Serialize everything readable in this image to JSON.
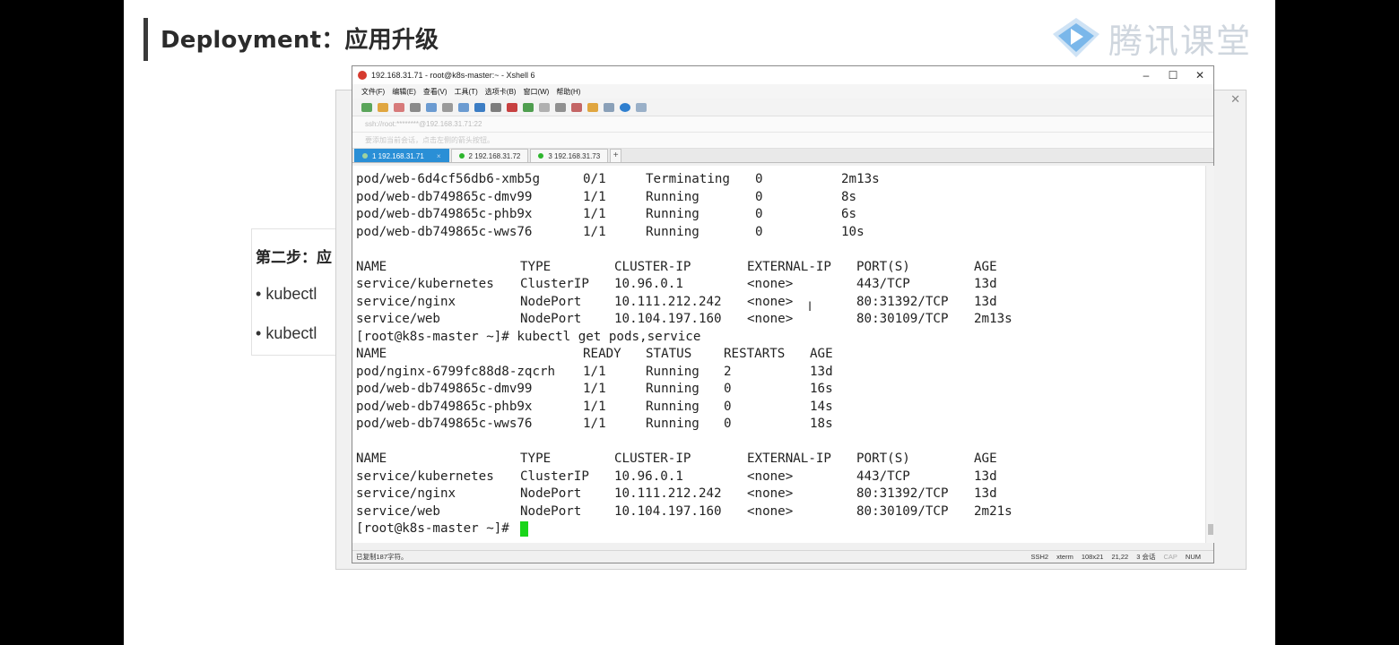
{
  "slide": {
    "title": "Deployment：应用升级",
    "logo_text": "腾讯课堂",
    "behind": {
      "step_label": "第二步：应",
      "bullets": [
        "kubectl",
        "kubectl"
      ]
    }
  },
  "window": {
    "title": "192.168.31.71 - root@k8s-master:~ - Xshell 6",
    "controls": [
      "–",
      "☐",
      "✕"
    ],
    "menu": [
      "文件(F)",
      "编辑(E)",
      "查看(V)",
      "工具(T)",
      "选项卡(B)",
      "窗口(W)",
      "帮助(H)"
    ],
    "address": "ssh://root:********@192.168.31.71:22",
    "hint": "要添加当前会话，点击左侧的箭头按钮。",
    "tabs": [
      {
        "label": "1 192.168.31.71",
        "active": true
      },
      {
        "label": "2 192.168.31.72",
        "active": false
      },
      {
        "label": "3 192.168.31.73",
        "active": false
      }
    ],
    "tab_add": "+",
    "status": {
      "left": "已复制187字符。",
      "items": [
        "SSH2",
        "xterm",
        "108x21",
        "21,22",
        "3 会话",
        "CAP",
        "NUM"
      ]
    }
  },
  "terminal": {
    "lines": [
      [
        "pod/web-6d4cf56db6-xmb5g",
        "0/1",
        "Terminating",
        "0",
        "2m13s"
      ],
      [
        "pod/web-db749865c-dmv99",
        "1/1",
        "Running",
        "0",
        "8s"
      ],
      [
        "pod/web-db749865c-phb9x",
        "1/1",
        "Running",
        "0",
        "6s"
      ],
      [
        "pod/web-db749865c-wws76",
        "1/1",
        "Running",
        "0",
        "10s"
      ],
      [],
      [
        "NAME",
        "TYPE",
        "CLUSTER-IP",
        "EXTERNAL-IP",
        "PORT(S)",
        "AGE"
      ],
      [
        "service/kubernetes",
        "ClusterIP",
        "10.96.0.1",
        "<none>",
        "443/TCP",
        "13d"
      ],
      [
        "service/nginx",
        "NodePort",
        "10.111.212.242",
        "<none>",
        "80:31392/TCP",
        "13d"
      ],
      [
        "service/web",
        "NodePort",
        "10.104.197.160",
        "<none>",
        "80:30109/TCP",
        "2m13s"
      ],
      [
        "[root@k8s-master ~]# kubectl get pods,service"
      ],
      [
        "NAME",
        "READY",
        "STATUS",
        "RESTARTS",
        "AGE"
      ],
      [
        "pod/nginx-6799fc88d8-zqcrh",
        "1/1",
        "Running",
        "2",
        "13d"
      ],
      [
        "pod/web-db749865c-dmv99",
        "1/1",
        "Running",
        "0",
        "16s"
      ],
      [
        "pod/web-db749865c-phb9x",
        "1/1",
        "Running",
        "0",
        "14s"
      ],
      [
        "pod/web-db749865c-wws76",
        "1/1",
        "Running",
        "0",
        "18s"
      ],
      [],
      [
        "NAME",
        "TYPE",
        "CLUSTER-IP",
        "EXTERNAL-IP",
        "PORT(S)",
        "AGE"
      ],
      [
        "service/kubernetes",
        "ClusterIP",
        "10.96.0.1",
        "<none>",
        "443/TCP",
        "13d"
      ],
      [
        "service/nginx",
        "NodePort",
        "10.111.212.242",
        "<none>",
        "80:31392/TCP",
        "13d"
      ],
      [
        "service/web",
        "NodePort",
        "10.104.197.160",
        "<none>",
        "80:30109/TCP",
        "2m21s"
      ],
      [
        "[root@k8s-master ~]# "
      ]
    ]
  },
  "colors": {
    "accent_tab": "#2a8fd6",
    "cursor": "#19d519",
    "session_dot": "#2db52d"
  }
}
